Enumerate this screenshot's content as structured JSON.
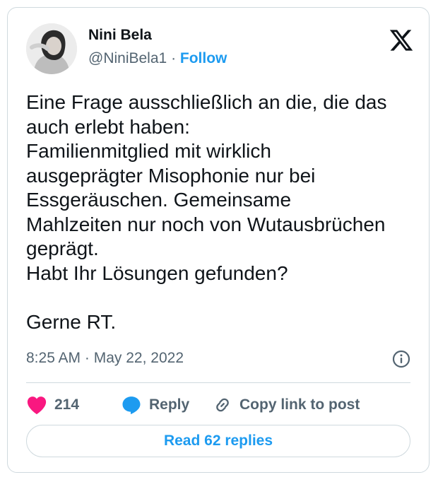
{
  "author": {
    "name": "Nini Bela",
    "handle": "@NiniBela1",
    "separator": "·",
    "follow_label": "Follow"
  },
  "tweet": {
    "text": "Eine Frage ausschließlich an die, die das\nauch erlebt haben:\nFamilienmitglied mit wirklich\nausgeprägter Misophonie nur bei\nEssgeräuschen. Gemeinsame\nMahlzeiten nur noch von Wutausbrüchen\ngeprägt.\nHabt Ihr Lösungen gefunden?\n\nGerne RT.",
    "time": "8:25 AM",
    "meta_separator": "·",
    "date": "May 22, 2022"
  },
  "actions": {
    "likes": "214",
    "reply_label": "Reply",
    "copy_link_label": "Copy link to post"
  },
  "read_replies_label": "Read 62 replies",
  "icons": {
    "logo": "x-logo-icon",
    "info": "info-icon",
    "like": "heart-icon",
    "reply": "reply-bubble-icon",
    "copy": "link-icon"
  },
  "colors": {
    "accent": "#1d9bf0",
    "like": "#f91880",
    "text": "#0f1419",
    "secondary": "#536471",
    "border": "#cfd9de"
  }
}
